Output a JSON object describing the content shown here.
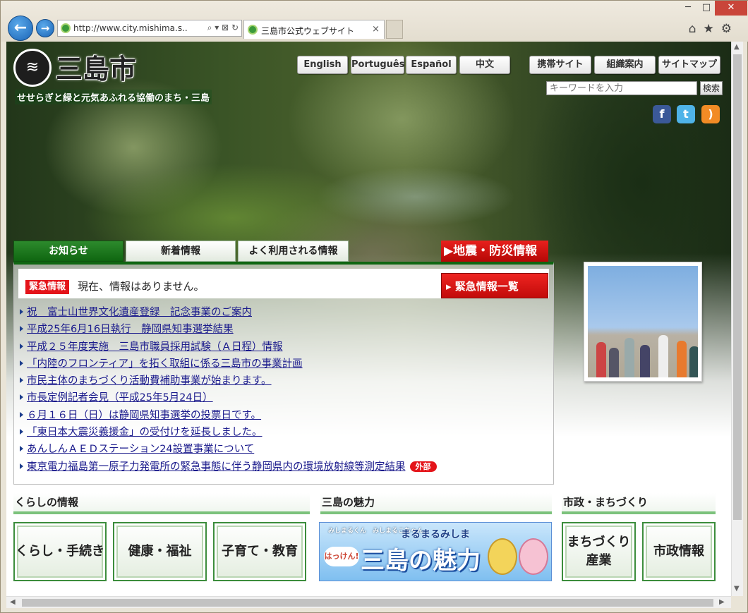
{
  "browser": {
    "url": "http://www.city.mishima.s..",
    "tab_title": "三島市公式ウェブサイト",
    "tab_close": "×",
    "address_tools": "⌕ ▾ ⊠ ↻",
    "window_min": "─",
    "window_max": "□",
    "window_close": "✕",
    "back": "←",
    "forward": "→",
    "toolbar_icons": "⌂★⚙"
  },
  "site": {
    "logo_mark": "≋",
    "logo_text": "三島市",
    "tagline": "せせらぎと緑と元気あふれる協働のまち・三島"
  },
  "languages": [
    "English",
    "Português",
    "Español",
    "中文"
  ],
  "utility_links": [
    "携帯サイト",
    "組織案内",
    "サイトマップ"
  ],
  "search": {
    "placeholder": "キーワードを入力",
    "button": "検索"
  },
  "social": {
    "facebook": "f",
    "twitter": "t",
    "rss": ")"
  },
  "tabs": [
    "お知らせ",
    "新着情報",
    "よく利用される情報"
  ],
  "disaster_link": "▶地震・防災情報",
  "alert": {
    "badge": "緊急情報",
    "text": "現在、情報はありません。",
    "list_button": "▸ 緊急情報一覧"
  },
  "news": [
    "祝　富士山世界文化遺産登録　記念事業のご案内",
    "平成25年6月16日執行　静岡県知事選挙結果",
    "平成２５年度実施　三島市職員採用試験（Ａ日程）情報",
    "「内陸のフロンティア」を拓く取組に係る三島市の事業計画",
    "市民主体のまちづくり活動費補助事業が始まります。",
    "市長定例記者会見（平成25年5月24日）",
    "６月１６日（日）は静岡県知事選挙の投票日です。",
    "「東日本大震災義援金」の受付けを延長しました。",
    "あんしんＡＥＤステーション24設置事業について",
    "東京電力福島第一原子力発電所の緊急事態に伴う静岡県内の環境放射線等測定結果"
  ],
  "external_badge": "外部",
  "sections": {
    "life": {
      "title": "くらしの情報",
      "buttons": [
        "くらし・手続き",
        "健康・福祉",
        "子育て・教育"
      ]
    },
    "charm": {
      "title": "三島の魅力",
      "banner_small": "みしまるくん　みしまるこちゃん",
      "banner_top": "まるまるみしま",
      "banner_hakken": "はっけん!",
      "banner_main": "三島の魅力"
    },
    "city": {
      "title": "市政・まちづくり",
      "buttons": [
        "まちづくり\n産業",
        "市政情報"
      ]
    }
  }
}
